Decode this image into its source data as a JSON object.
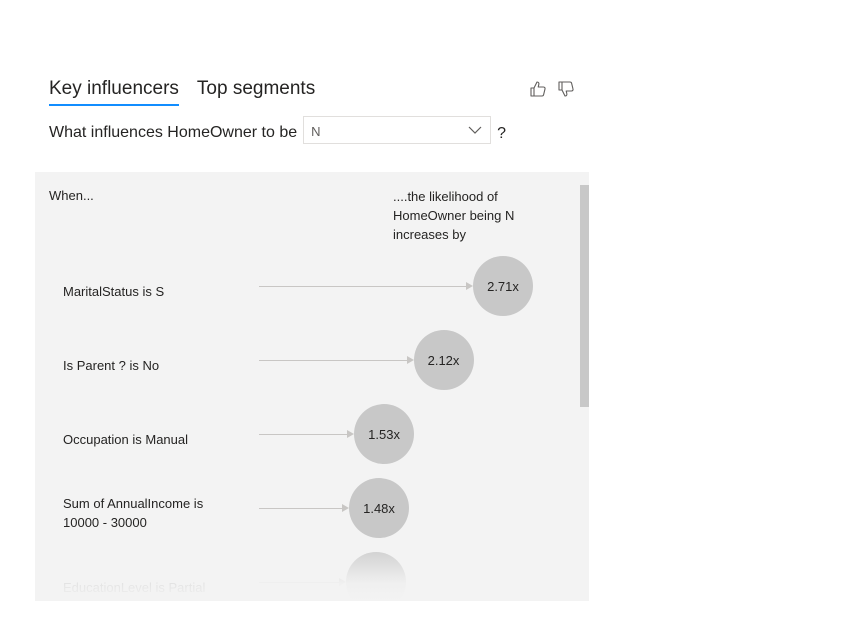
{
  "tabs": [
    {
      "label": "Key influencers",
      "active": true
    },
    {
      "label": "Top segments",
      "active": false
    }
  ],
  "feedback": {
    "like_icon": "thumbs-up-icon",
    "dislike_icon": "thumbs-down-icon"
  },
  "question": {
    "prefix": "What influences HomeOwner to be",
    "selected_value": "N",
    "suffix": "?"
  },
  "columns": {
    "when": "When...",
    "likelihood": "....the likelihood of HomeOwner being N increases by"
  },
  "influencers": [
    {
      "label": "MaritalStatus is S",
      "value": "2.71x",
      "factor": 2.71
    },
    {
      "label": "Is Parent ? is No",
      "value": "2.12x",
      "factor": 2.12
    },
    {
      "label": "Occupation is Manual",
      "value": "1.53x",
      "factor": 1.53
    },
    {
      "label": "Sum of AnnualIncome is 10000 - 30000",
      "value": "1.48x",
      "factor": 1.48
    },
    {
      "label": "EducationLevel is Partial",
      "value": "",
      "factor": 1.45
    }
  ],
  "colors": {
    "accent": "#118dff",
    "panel": "#f3f3f3",
    "bubble": "#c8c8c8",
    "line": "#c8c6c4"
  }
}
